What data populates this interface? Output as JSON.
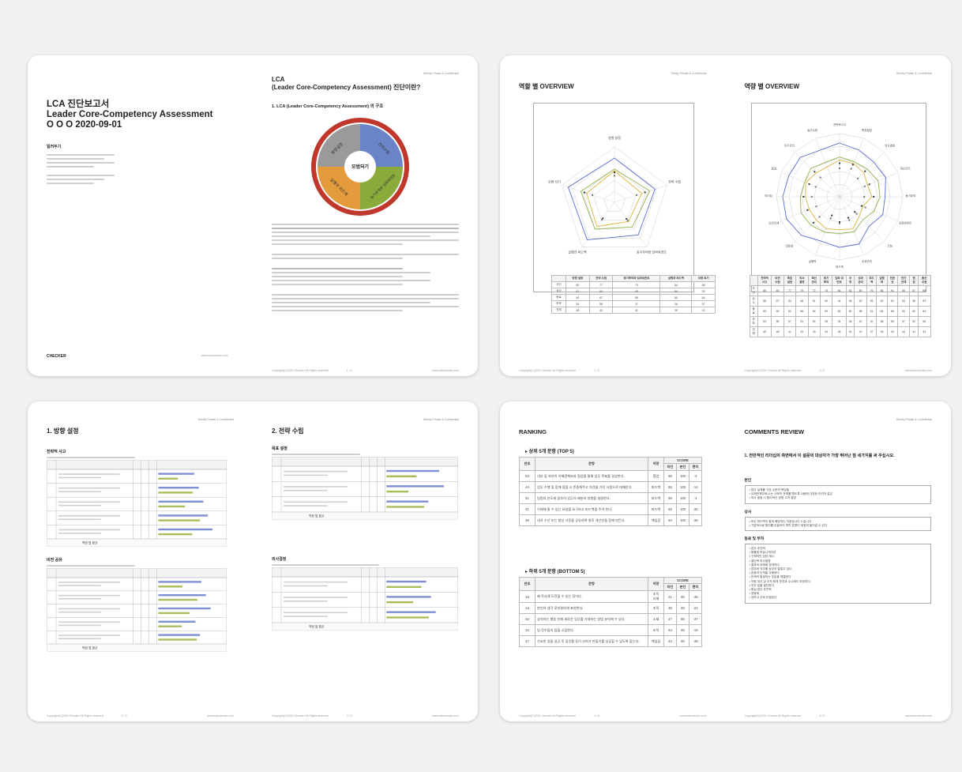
{
  "spreads": [
    {
      "left": {
        "report_title": [
          "LCA 진단보고서",
          "Leader Core-Competency Assessment",
          "O O O 2020-09-01"
        ],
        "intro_heading": "일러두기",
        "brand": "CHECKER",
        "website": "www.educhecker.com"
      },
      "right": {
        "confidential": "Strictly Private & Confidential",
        "title": "LCA\n(Leader Core-Competency Assessment) 진단이란?",
        "section": "1. LCA (Leader Core-Competency Assessment) 의 구조",
        "core": "모범되기",
        "segments": [
          "방향설정",
          "전략수립",
          "동기부여와\n임파워먼트",
          "실행과\n피드백"
        ],
        "copyright": "Copyright(C)2020 Checker All Rights reserved",
        "page": "1 / 5",
        "website": "www.educhecker.com"
      }
    },
    {
      "left": {
        "title": "역할 별 OVERVIEW",
        "axes": [
          "방향 설정",
          "전략 수립",
          "동기부여와\n임파워먼트",
          "실행과\n피드백",
          "모범 되기"
        ],
        "table_cols": [
          "",
          "방향 설정",
          "전략 수립",
          "동기부여와\n임파워먼트",
          "실행과\n피드백",
          "모범 되기"
        ],
        "table_rows": [
          [
            "자신",
            "80",
            "77",
            "73",
            "84",
            "88"
          ],
          [
            "상사",
            "57",
            "52",
            "43",
            "54",
            "53"
          ],
          [
            "동료",
            "60",
            "67",
            "55",
            "60",
            "64"
          ],
          [
            "부하",
            "54",
            "58",
            "37",
            "36",
            "57"
          ],
          [
            "전체",
            "48",
            "42",
            "41",
            "39",
            "42"
          ]
        ],
        "confidential": "Strictly Private & Confidential",
        "copyright": "Copyright(C)2020 Checker All Rights reserved",
        "page": "2 / 5"
      },
      "right": {
        "title": "역량 별 OVERVIEW",
        "axes": [
          "전략적사고",
          "목표설정",
          "의사결정",
          "혁신관리",
          "동기부여",
          "임파워먼트",
          "코칭",
          "성과관리",
          "피드백",
          "실행력",
          "전문성",
          "인간관계",
          "리더십",
          "협업",
          "자기관리",
          "솔선수범"
        ],
        "table_cols": [
          "",
          "전략적\n사고",
          "비전\n수립",
          "목표\n설정",
          "의사\n결정",
          "혁신\n관리",
          "동기\n부여",
          "임파\n워먼트",
          "코칭",
          "성과\n관리",
          "피드백",
          "실행\n력",
          "전문\n성",
          "인간\n관계",
          "협업",
          "솔선\n수범"
        ],
        "table_rows": [
          [
            "자신",
            "85",
            "80",
            "77",
            "79",
            "72",
            "74",
            "66",
            "81",
            "80",
            "76",
            "86",
            "91",
            "90",
            "87",
            "88"
          ],
          [
            "상사",
            "58",
            "57",
            "54",
            "48",
            "51",
            "40",
            "44",
            "55",
            "52",
            "55",
            "52",
            "52",
            "54",
            "58",
            "53"
          ],
          [
            "동료",
            "63",
            "60",
            "62",
            "66",
            "64",
            "59",
            "52",
            "60",
            "58",
            "61",
            "64",
            "66",
            "62",
            "60",
            "64"
          ],
          [
            "부하",
            "53",
            "55",
            "57",
            "51",
            "54",
            "38",
            "34",
            "36",
            "40",
            "32",
            "58",
            "55",
            "57",
            "52",
            "56"
          ],
          [
            "전체",
            "45",
            "48",
            "41",
            "43",
            "39",
            "44",
            "38",
            "40",
            "42",
            "37",
            "45",
            "40",
            "44",
            "41",
            "43"
          ]
        ],
        "confidential": "Strictly Private & Confidential",
        "copyright": "Copyright(C)2020 Checker All Rights reserved",
        "page": "3 / 5",
        "website": "www.educhecker.com"
      }
    },
    {
      "left": {
        "title": "1. 방향 설정",
        "sub1": "전략적 사고",
        "sub2": "비전 공유",
        "total": "역량 별 평균",
        "confidential": "Strictly Private & Confidential",
        "copyright": "Copyright(C)2020 Checker All Rights reserved",
        "page": "3 / 5",
        "website": "www.educhecker.com"
      },
      "right": {
        "title": "2. 전략 수립",
        "sub1": "목표 설정",
        "sub2": "의사결정",
        "total": "역량 별 평균",
        "confidential": "Strictly Private & Confidential",
        "copyright": "Copyright(C)2020 Checker All Rights reserved",
        "page": "3 / 5",
        "website": "www.educhecker.com"
      }
    },
    {
      "left": {
        "title": "RANKING",
        "top_heading": "▸ 상위 5개 문항 (TOP 5)",
        "bottom_heading": "▸ 하위 5개 문항 (BOTTOM 5)",
        "cols": [
          "번호",
          "문항",
          "역량",
          "SCORE",
          "타인",
          "본인",
          "편차"
        ],
        "top_rows": [
          [
            "53",
            "내부 및 외부의 이해관계자와 협업을 통해 업무 목표를 달성한다.",
            "협업",
            "96",
            "100",
            "-4"
          ],
          [
            "44",
            "업무 수행 및 함께 일할 시 존중해주고 의견을 가진 사람으로 대해준다.",
            "피드백",
            "86",
            "100",
            "-14"
          ],
          [
            "51",
            "팀원의 온도에 맞추어 업무의 배분과 방향을 설명한다.",
            "피드백",
            "96",
            "100",
            "-4"
          ],
          [
            "41",
            "이해해 줄 수 있는 요청을 요구하고 피드백을 주려 한다.",
            "피드백",
            "65",
            "100",
            "-35"
          ],
          [
            "46",
            "내가 수신 또는 발신 기준을 공유하며 향후 개선안을 함께 만든다.",
            "책임감",
            "64",
            "100",
            "-36"
          ]
        ],
        "bottom_rows": [
          [
            "33",
            "때 목사례 도전할 수 있는 장이다.",
            "조직\n이해",
            "21",
            "80",
            "-46"
          ],
          [
            "13",
            "본인의 생각 로지컬하게 표현한다.",
            "조직",
            "35",
            "60",
            "-24"
          ],
          [
            "32",
            "상의하는 행동 인해 새로운 업무를 기대하는 방법 분석에 수 있다.",
            "소재",
            "27",
            "80",
            "-37"
          ],
          [
            "34",
            "팀 전우들의 팀을 소집한다.",
            "조직",
            "64",
            "80",
            "-16"
          ],
          [
            "47",
            "가요한 일을 성공 후 업무를 동기 부여가 만들기를 성공할 수 있도록 돕는다.",
            "책임감",
            "42",
            "80",
            "-38"
          ]
        ],
        "copyright": "Copyright(C)2020 Checker All Rights reserved",
        "page": "4 / 5",
        "website": "www.educhecker.com"
      },
      "right": {
        "title": "COMMENTS REVIEW",
        "question": "1. 전반적인 리더십의 측면에서 이 설문의 대상자가 가장 뛰어난 점 세가지를 써 주십시오.",
        "groups": [
          {
            "label": "본인",
            "items": [
              "업무 설계를 구분 수준의 책임을",
              "이해관계자와 나는 나와의 관계를 맺도록 사람에 다양한 의견과 같은",
              "의사 결정 시 합리적인 방향 고려 결정"
            ]
          },
          {
            "label": "상사",
            "items": [
              "모두 피드백이 잘되 예방하는 하였습니다 느낍니다.",
              "기본적으로 합리를 이끌어가 파악 분명이 세워져 들어갈 수 있다."
            ]
          },
          {
            "label": "동료 및 부하",
            "items": [
              "업무 추진력",
              "원활한 커뮤니케이션",
              "구체적인 성장 제시",
              "결단력 의사결정",
              "결과의 이해에 엄격하다",
              "업무와 직무를 상당히 잘알고 있다",
              "존중과 인격을 사용한다",
              "문제의 발생하는 부분을 해결한다",
              "약점 개선 및 조직 체계 운영과 수나에도 마련하다",
              "직무 일을 결단한다",
              "확실 업무 추진력",
              "공동체",
              "강하고 신뢰 인정된다"
            ]
          }
        ],
        "confidential": "Strictly Private & Confidential",
        "copyright": "Copyright(C)2020 Checker All Rights reserved",
        "page": "5 / 5",
        "website": "www.educhecker.com"
      }
    }
  ],
  "colors": {
    "blue": "#5b6ccf",
    "yellow": "#d9b33e",
    "green": "#8fb24a",
    "red": "#c0382b",
    "pie_blue": "#6b84c8",
    "pie_green": "#8aaa3c",
    "pie_orange": "#e39b3b",
    "pie_grey": "#9a9a9a"
  }
}
